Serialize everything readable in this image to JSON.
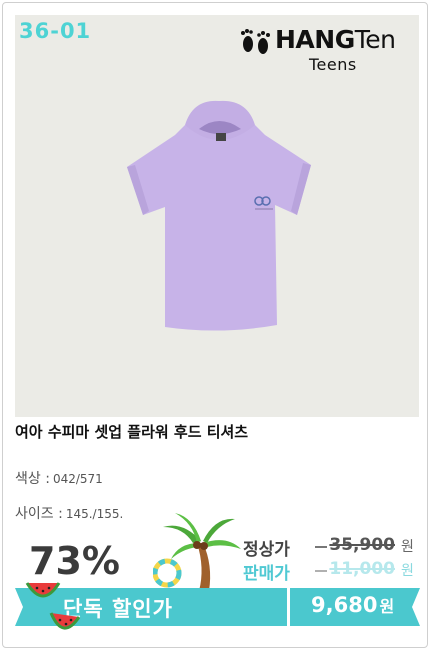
{
  "product_image": {
    "code_badge": "36-01",
    "brand": {
      "name_bold": "HANG",
      "name_light": "Ten",
      "sub": "Teens"
    }
  },
  "product": {
    "title": "여아 수피마 셋업 플라워 후드 티셔츠",
    "color_label": "색상 :",
    "color_value": "042/571",
    "size_label": "사이즈 :",
    "size_value": "145./155."
  },
  "pricing": {
    "discount_percent": "73%",
    "regular_label": "정상가",
    "regular_price": "35,900",
    "sale_label": "판매가",
    "sale_price": "11,000",
    "currency": "원",
    "exclusive_label": "단독 할인가",
    "exclusive_price": "9,680",
    "exclusive_currency": "원"
  },
  "colors": {
    "accent": "#4bc8ce",
    "badge": "#4ed3d4",
    "shirt": "#c7b3e8",
    "photo_bg": "#ebebe6"
  }
}
